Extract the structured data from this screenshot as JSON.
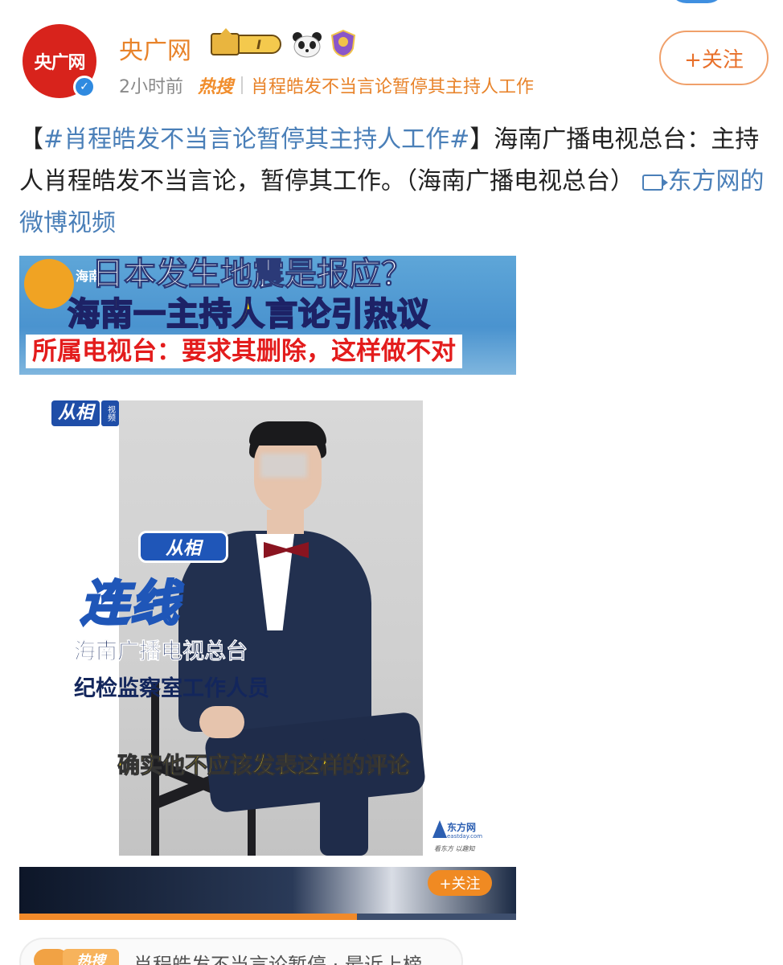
{
  "header": {
    "username": "央广网",
    "avatar_text": "央广网",
    "vip_level": "I",
    "time": "2小时前",
    "hot_label": "热搜",
    "hot_topic": "肖程皓发不当言论暂停其主持人工作",
    "follow_label": "+关注"
  },
  "post": {
    "bracket_open": "【",
    "hashtag": "#肖程皓发不当言论暂停其主持人工作#",
    "bracket_close": "】",
    "body": "海南广播电视总台：主持人肖程皓发不当言论，暂停其工作。（海南广播电视总台）",
    "video_link": "东方网的微博视频"
  },
  "video": {
    "banner_logo_text": "海南",
    "banner_line1": "日本发生地震是报应？",
    "banner_line2": "海南一主持人言论引热议",
    "banner_line3": "所属电视台：要求其删除，这样做不对",
    "brand": "从相",
    "brand_sub": "视频",
    "connect_brand": "从相",
    "connect_title": "连线",
    "caption1": "海南广播电视总台",
    "caption2": "纪检监察室工作人员",
    "subtitle": "确实他不应该发表这样的评论",
    "watermark_name": "东方网",
    "watermark_url": "eastday.com",
    "watermark_slogan": "看东方 以趣知",
    "follow_label": "+关注",
    "progress_fraction": 0.68
  },
  "hotbar": {
    "label": "热搜",
    "text": "肖程皓发不当言论暂停 · 最近上榜"
  },
  "colors": {
    "accent_orange": "#e8832a",
    "link_blue": "#4a7fb8",
    "avatar_red": "#d8231c",
    "verified_blue": "#2f8ae0"
  }
}
